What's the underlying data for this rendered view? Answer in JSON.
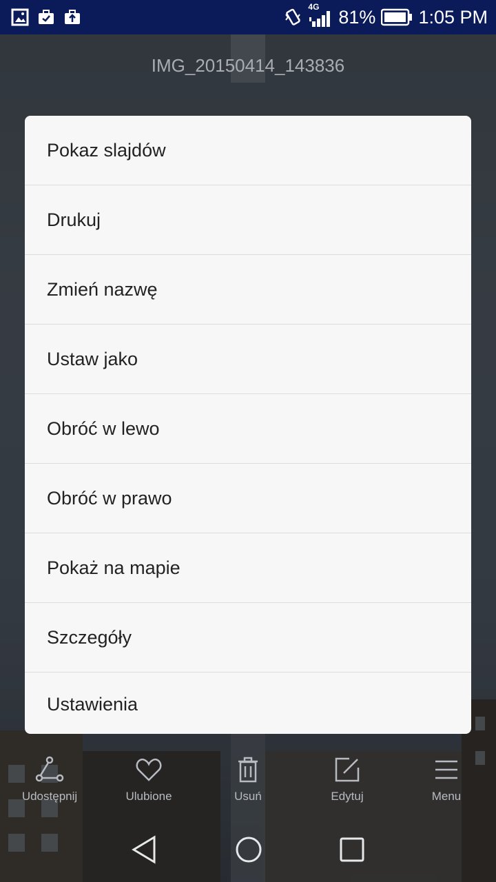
{
  "status_bar": {
    "network": "4G",
    "battery_percent": "81%",
    "time": "1:05 PM",
    "left_icons": [
      "gallery-icon",
      "briefcase-check-icon",
      "briefcase-upload-icon"
    ],
    "right_icons": [
      "vibrate-icon",
      "signal-icon",
      "battery-icon"
    ]
  },
  "header": {
    "title": "IMG_20150414_143836"
  },
  "menu": {
    "items": [
      "Pokaz slajdów",
      "Drukuj",
      "Zmień nazwę",
      "Ustaw jako",
      "Obróć w lewo",
      "Obróć w prawo",
      "Pokaż na mapie",
      "Szczegóły",
      "Ustawienia"
    ]
  },
  "toolbar": {
    "items": [
      {
        "label": "Udostępnij",
        "icon": "share-icon"
      },
      {
        "label": "Ulubione",
        "icon": "heart-icon"
      },
      {
        "label": "Usuń",
        "icon": "trash-icon"
      },
      {
        "label": "Edytuj",
        "icon": "edit-icon"
      },
      {
        "label": "Menu",
        "icon": "menu-icon"
      }
    ]
  },
  "navbar": {
    "icons": [
      "back-icon",
      "home-icon",
      "recents-icon"
    ]
  },
  "colors": {
    "status_bar_bg": "#0b1a58",
    "menu_bg": "#f7f7f7",
    "menu_text": "#222222"
  }
}
